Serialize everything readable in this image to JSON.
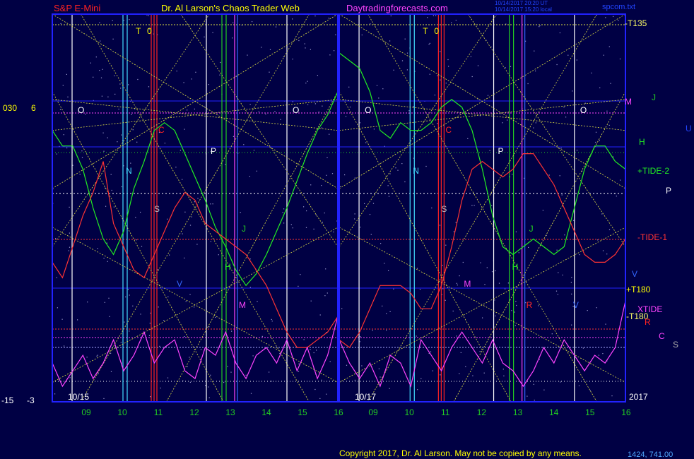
{
  "header": {
    "symbol": "S&P E-Mini",
    "title": "Dr. Al Larson's Chaos Trader Web",
    "site": "Daytradingforecasts.com",
    "stamp_1": "10/14/2017 20:20 UT",
    "stamp_2": "10/14/2017 15:20 local",
    "file": "spcom.txt"
  },
  "left_scale": {
    "top_a": "030",
    "top_b": "6",
    "bottom_a": "-15",
    "bottom_b": "-3"
  },
  "footer": {
    "copyright": "Copyright 2017, Dr. Al Larson. May not be copied by any means.",
    "coords": "1424, 741.00"
  },
  "colors": {
    "background": "#000044",
    "grid_blue": "#2222ff",
    "tide_green": "#00cc00",
    "tide_red": "#ff0000",
    "xtide_magenta": "#ff44ff",
    "diagonal_yellow": "#dddd44",
    "cyan": "#44ddff"
  },
  "right_labels": [
    {
      "text": "-T135",
      "color": "#ffff66"
    },
    {
      "text": "M",
      "color": "#ff44ff"
    },
    {
      "text": "J",
      "color": "#22cc22"
    },
    {
      "text": "U",
      "color": "#2244ff"
    },
    {
      "text": "H",
      "color": "#22ee22"
    },
    {
      "text": "+TIDE-2",
      "color": "#22ee22"
    },
    {
      "text": "P",
      "color": "#ffffff"
    },
    {
      "text": "-TIDE-1",
      "color": "#ff3333"
    },
    {
      "text": "V",
      "color": "#3366ff"
    },
    {
      "text": "+T180",
      "color": "#ffff00"
    },
    {
      "text": "XTIDE",
      "color": "#ff44ff"
    },
    {
      "text": "-T180",
      "color": "#ffff66"
    },
    {
      "text": "R",
      "color": "#ff2222"
    },
    {
      "text": "C",
      "color": "#ff44ff"
    },
    {
      "text": "S",
      "color": "#aaaaaa"
    },
    {
      "text": "2017",
      "color": "#ffffff"
    }
  ],
  "chart_data": {
    "type": "line",
    "panels": [
      {
        "date_label": "10/15",
        "x_ticks": [
          "09",
          "10",
          "11",
          "12",
          "13",
          "14",
          "15",
          "16"
        ],
        "markers": [
          {
            "text": "T",
            "color": "#ffff00"
          },
          {
            "text": "0",
            "color": "#ffff00"
          },
          {
            "text": "O",
            "color": "#ffffff"
          },
          {
            "text": "O",
            "color": "#ffffff"
          },
          {
            "text": "C",
            "color": "#ff2222"
          },
          {
            "text": "N",
            "color": "#44ddff"
          },
          {
            "text": "P",
            "color": "#ffffff"
          },
          {
            "text": "S",
            "color": "#bbbbbb"
          },
          {
            "text": "J",
            "color": "#22cc22"
          },
          {
            "text": "H",
            "color": "#22ee22"
          },
          {
            "text": "V",
            "color": "#3366ff"
          },
          {
            "text": "M",
            "color": "#ff44ff"
          }
        ]
      },
      {
        "date_label": "10/17",
        "x_ticks": [
          "09",
          "10",
          "11",
          "12",
          "13",
          "14",
          "15",
          "16"
        ],
        "markers": [
          {
            "text": "T",
            "color": "#ffff00"
          },
          {
            "text": "0",
            "color": "#ffff00"
          },
          {
            "text": "O",
            "color": "#ffffff"
          },
          {
            "text": "O",
            "color": "#ffffff"
          },
          {
            "text": "C",
            "color": "#ff2222"
          },
          {
            "text": "N",
            "color": "#44ddff"
          },
          {
            "text": "P",
            "color": "#ffffff"
          },
          {
            "text": "S",
            "color": "#bbbbbb"
          },
          {
            "text": "J",
            "color": "#22cc22"
          },
          {
            "text": "H",
            "color": "#22ee22"
          },
          {
            "text": "M",
            "color": "#ff44ff"
          },
          {
            "text": "R",
            "color": "#ff2222"
          },
          {
            "text": "V",
            "color": "#3366ff"
          }
        ]
      }
    ],
    "series": [
      {
        "name": "+TIDE-2",
        "color": "#22ee22",
        "panel1": [
          0.7,
          0.66,
          0.66,
          0.6,
          0.5,
          0.42,
          0.38,
          0.44,
          0.55,
          0.62,
          0.7,
          0.72,
          0.7,
          0.64,
          0.58,
          0.52,
          0.45,
          0.4,
          0.34,
          0.3,
          0.33,
          0.38,
          0.44,
          0.5,
          0.57,
          0.64,
          0.7,
          0.74,
          0.8
        ],
        "panel2": [
          0.9,
          0.88,
          0.86,
          0.8,
          0.7,
          0.68,
          0.72,
          0.7,
          0.7,
          0.72,
          0.76,
          0.78,
          0.76,
          0.7,
          0.6,
          0.48,
          0.4,
          0.38,
          0.4,
          0.42,
          0.4,
          0.38,
          0.4,
          0.5,
          0.6,
          0.66,
          0.66,
          0.62,
          0.6
        ]
      },
      {
        "name": "-TIDE-1",
        "color": "#ff3333",
        "panel1": [
          0.36,
          0.32,
          0.4,
          0.48,
          0.54,
          0.62,
          0.46,
          0.4,
          0.34,
          0.32,
          0.38,
          0.44,
          0.5,
          0.54,
          0.52,
          0.46,
          0.44,
          0.42,
          0.4,
          0.38,
          0.34,
          0.3,
          0.24,
          0.18,
          0.14,
          0.14,
          0.16,
          0.18,
          0.22
        ],
        "panel2": [
          0.16,
          0.14,
          0.18,
          0.24,
          0.3,
          0.3,
          0.3,
          0.28,
          0.24,
          0.24,
          0.3,
          0.4,
          0.52,
          0.6,
          0.62,
          0.6,
          0.58,
          0.6,
          0.64,
          0.64,
          0.6,
          0.56,
          0.5,
          0.44,
          0.38,
          0.36,
          0.36,
          0.38,
          0.42
        ]
      },
      {
        "name": "XTIDE",
        "color": "#ff44ff",
        "panel1": [
          0.1,
          0.04,
          0.08,
          0.12,
          0.06,
          0.1,
          0.16,
          0.08,
          0.12,
          0.18,
          0.1,
          0.14,
          0.16,
          0.08,
          0.06,
          0.14,
          0.12,
          0.18,
          0.1,
          0.06,
          0.12,
          0.14,
          0.1,
          0.16,
          0.08,
          0.14,
          0.06,
          0.12,
          0.22
        ],
        "panel2": [
          0.16,
          0.1,
          0.06,
          0.1,
          0.04,
          0.12,
          0.1,
          0.04,
          0.16,
          0.12,
          0.08,
          0.14,
          0.18,
          0.14,
          0.1,
          0.16,
          0.1,
          0.08,
          0.04,
          0.08,
          0.14,
          0.1,
          0.16,
          0.12,
          0.08,
          0.12,
          0.1,
          0.14,
          0.26
        ]
      }
    ]
  }
}
